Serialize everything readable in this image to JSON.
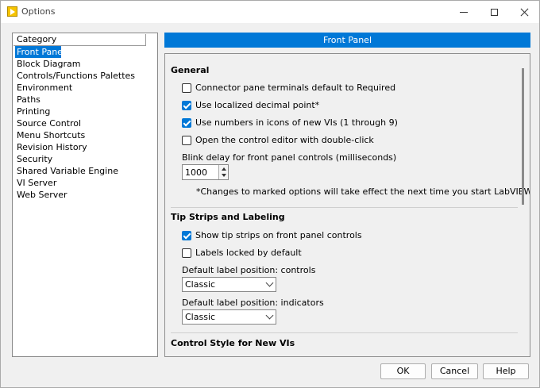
{
  "window": {
    "title": "Options",
    "icon": "labview-icon"
  },
  "category": {
    "header": "Category",
    "items": [
      {
        "label": "Front Panel",
        "selected": true
      },
      {
        "label": "Block Diagram"
      },
      {
        "label": "Controls/Functions Palettes"
      },
      {
        "label": "Environment"
      },
      {
        "label": "Paths"
      },
      {
        "label": "Printing"
      },
      {
        "label": "Source Control"
      },
      {
        "label": "Menu Shortcuts"
      },
      {
        "label": "Revision History"
      },
      {
        "label": "Security"
      },
      {
        "label": "Shared Variable Engine"
      },
      {
        "label": "VI Server"
      },
      {
        "label": "Web Server"
      }
    ]
  },
  "panel": {
    "title": "Front Panel",
    "sections": {
      "general": {
        "title": "General",
        "options": [
          {
            "label": "Connector pane terminals default to Required",
            "checked": false
          },
          {
            "label": "Use localized decimal point*",
            "checked": true
          },
          {
            "label": "Use numbers in icons of new VIs (1 through 9)",
            "checked": true
          },
          {
            "label": "Open the control editor with double-click",
            "checked": false
          }
        ],
        "blink_label": "Blink delay for front panel controls (milliseconds)",
        "blink_value": "1000",
        "note": "*Changes to marked options will take effect the next time you start LabVIEW."
      },
      "tips": {
        "title": "Tip Strips and Labeling",
        "options": [
          {
            "label": "Show tip strips on front panel controls",
            "checked": true
          },
          {
            "label": "Labels locked by default",
            "checked": false
          }
        ],
        "controls_label": "Default label position: controls",
        "controls_value": "Classic",
        "indicators_label": "Default label position: indicators",
        "indicators_value": "Classic"
      },
      "style": {
        "title": "Control Style for New VIs"
      }
    }
  },
  "buttons": {
    "ok": "OK",
    "cancel": "Cancel",
    "help": "Help"
  }
}
